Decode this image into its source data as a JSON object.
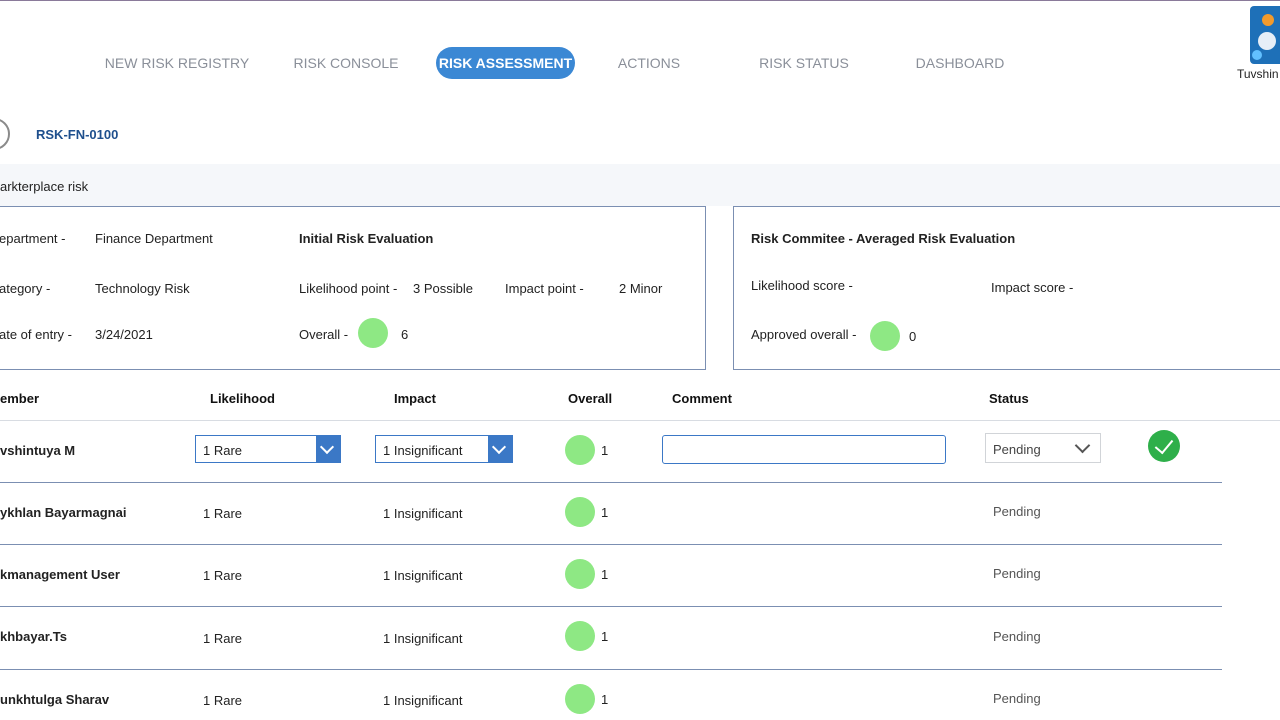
{
  "nav": {
    "items": [
      {
        "label": "NEW RISK REGISTRY"
      },
      {
        "label": "RISK CONSOLE"
      },
      {
        "label": "RISK ASSESSMENT"
      },
      {
        "label": "ACTIONS"
      },
      {
        "label": "RISK STATUS"
      },
      {
        "label": "DASHBOARD"
      }
    ],
    "active": "RISK ASSESSMENT"
  },
  "user": {
    "name": "Tuvshin"
  },
  "risk": {
    "id": "RSK-FN-0100",
    "title": "arkterplace risk"
  },
  "details": {
    "department_label": "epartment -",
    "department_value": "Finance Department",
    "category_label": "ategory -",
    "category_value": "Technology Risk",
    "date_label": "ate of entry -",
    "date_value": "3/24/2021"
  },
  "initial": {
    "heading": "Initial Risk Evaluation",
    "likelihood_label": "Likelihood point -",
    "likelihood_value": "3 Possible",
    "impact_label": "Impact point -",
    "impact_value": "2 Minor",
    "overall_label": "Overall -",
    "overall_value": "6",
    "overall_color": "#8ee884"
  },
  "committee": {
    "heading": "Risk Commitee - Averaged Risk Evaluation",
    "likelihood_label": "Likelihood score -",
    "impact_label": "Impact score -",
    "approved_label": "Approved overall -",
    "approved_value": "0",
    "approved_color": "#8ee884"
  },
  "table": {
    "headers": {
      "member": "ember",
      "likelihood": "Likelihood",
      "impact": "Impact",
      "overall": "Overall",
      "comment": "Comment",
      "status": "Status"
    },
    "edit_row": {
      "name": "vshintuya M",
      "likelihood": "1 Rare",
      "impact": "1 Insignificant",
      "overall": "1",
      "comment": "",
      "status": "Pending"
    },
    "rows": [
      {
        "name": "ykhlan Bayarmagnai",
        "likelihood": "1 Rare",
        "impact": "1 Insignificant",
        "overall": "1",
        "status": "Pending"
      },
      {
        "name": "kmanagement User",
        "likelihood": "1 Rare",
        "impact": "1 Insignificant",
        "overall": "1",
        "status": "Pending"
      },
      {
        "name": "khbayar.Ts",
        "likelihood": "1 Rare",
        "impact": "1 Insignificant",
        "overall": "1",
        "status": "Pending"
      },
      {
        "name": "unkhtulga Sharav",
        "likelihood": "1 Rare",
        "impact": "1 Insignificant",
        "overall": "1",
        "status": "Pending"
      }
    ]
  },
  "colors": {
    "accent": "#3b88d4",
    "score_green": "#8ee884",
    "approve_green": "#2eaf4a"
  }
}
